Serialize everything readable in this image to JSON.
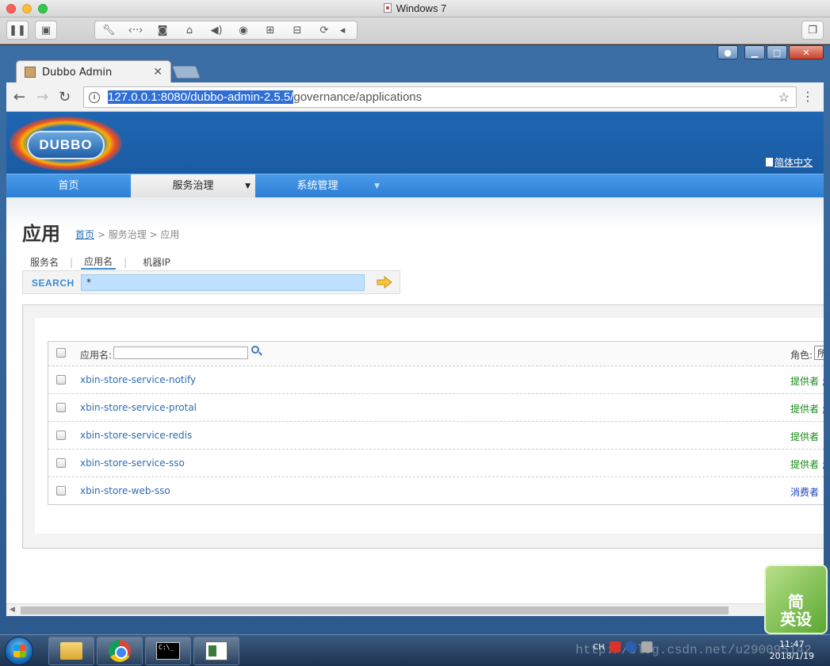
{
  "mac_window": {
    "title": "Windows 7"
  },
  "browser": {
    "tab_title": "Dubbo Admin",
    "url_selected": "127.0.0.1:8080/dubbo-admin-2.5.5/",
    "url_rest": "governance/applications"
  },
  "dubbo": {
    "logo_text": "DUBBO",
    "lang_link": "简体中文",
    "menu": [
      {
        "label": "首页"
      },
      {
        "label": "服务治理",
        "caret": "▼"
      },
      {
        "label": "系统管理",
        "caret": "▼"
      }
    ],
    "page_title": "应用",
    "breadcrumb": {
      "home": "首页",
      "sep1": " > ",
      "section": "服务治理",
      "sep2": " > ",
      "current": "应用"
    },
    "subtabs": [
      {
        "label": "服务名"
      },
      {
        "label": "应用名"
      },
      {
        "label": "机器IP"
      }
    ],
    "subtab_sep": "|",
    "search": {
      "label": "SEARCH",
      "value": "*"
    },
    "table": {
      "app_name_label": "应用名:",
      "role_label": "角色:",
      "role_select_value": "所",
      "rows": [
        {
          "app": "xbin-store-service-notify",
          "role": "提供者 ;"
        },
        {
          "app": "xbin-store-service-protal",
          "role": "提供者 ;"
        },
        {
          "app": "xbin-store-service-redis",
          "role": "提供者"
        },
        {
          "app": "xbin-store-service-sso",
          "role": "提供者 ;"
        },
        {
          "app": "xbin-store-web-sso",
          "role": "消费者"
        }
      ]
    }
  },
  "ime": {
    "line1": "简",
    "line2": "英设"
  },
  "taskbar": {
    "cmd_text": "C:\\_",
    "tray_lang": "CH",
    "clock_time": "11:47",
    "clock_date": "2018/1/19",
    "watermark": "http://blog.csdn.net/u290095142"
  }
}
